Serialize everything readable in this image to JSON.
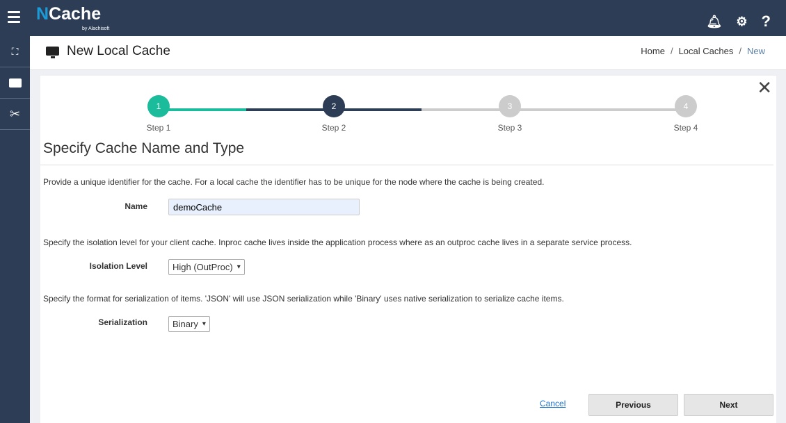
{
  "app": {
    "logo_text": "NCache",
    "logo_sub": "by Alachisoft"
  },
  "page": {
    "title": "New Local Cache"
  },
  "breadcrumb": [
    "Home",
    "Local Caches",
    "New"
  ],
  "steps": [
    {
      "num": "1",
      "label": "Step 1",
      "state": "done"
    },
    {
      "num": "2",
      "label": "Step 2",
      "state": "active"
    },
    {
      "num": "3",
      "label": "Step 3",
      "state": "pending"
    },
    {
      "num": "4",
      "label": "Step 4",
      "state": "pending"
    }
  ],
  "colors": {
    "header": "#2c3d55",
    "done": "#1abc9c",
    "active": "#2c3d55",
    "pending": "#cccccc"
  },
  "form": {
    "heading": "Specify Cache Name and Type",
    "name_desc": "Provide a unique identifier for the cache. For a local cache the identifier has to be unique for the node where the cache is being created.",
    "name_label": "Name",
    "name_value": "demoCache",
    "isolation_desc": "Specify the isolation level for your client cache. Inproc cache lives inside the application process where as an outproc cache lives in a separate service process.",
    "isolation_label": "Isolation Level",
    "isolation_value": "High (OutProc)",
    "serial_desc": "Specify the format for serialization of items. 'JSON' will use JSON serialization while 'Binary' uses native serialization to serialize cache items.",
    "serial_label": "Serialization",
    "serial_value": "Binary"
  },
  "actions": {
    "cancel": "Cancel",
    "previous": "Previous",
    "next": "Next"
  }
}
